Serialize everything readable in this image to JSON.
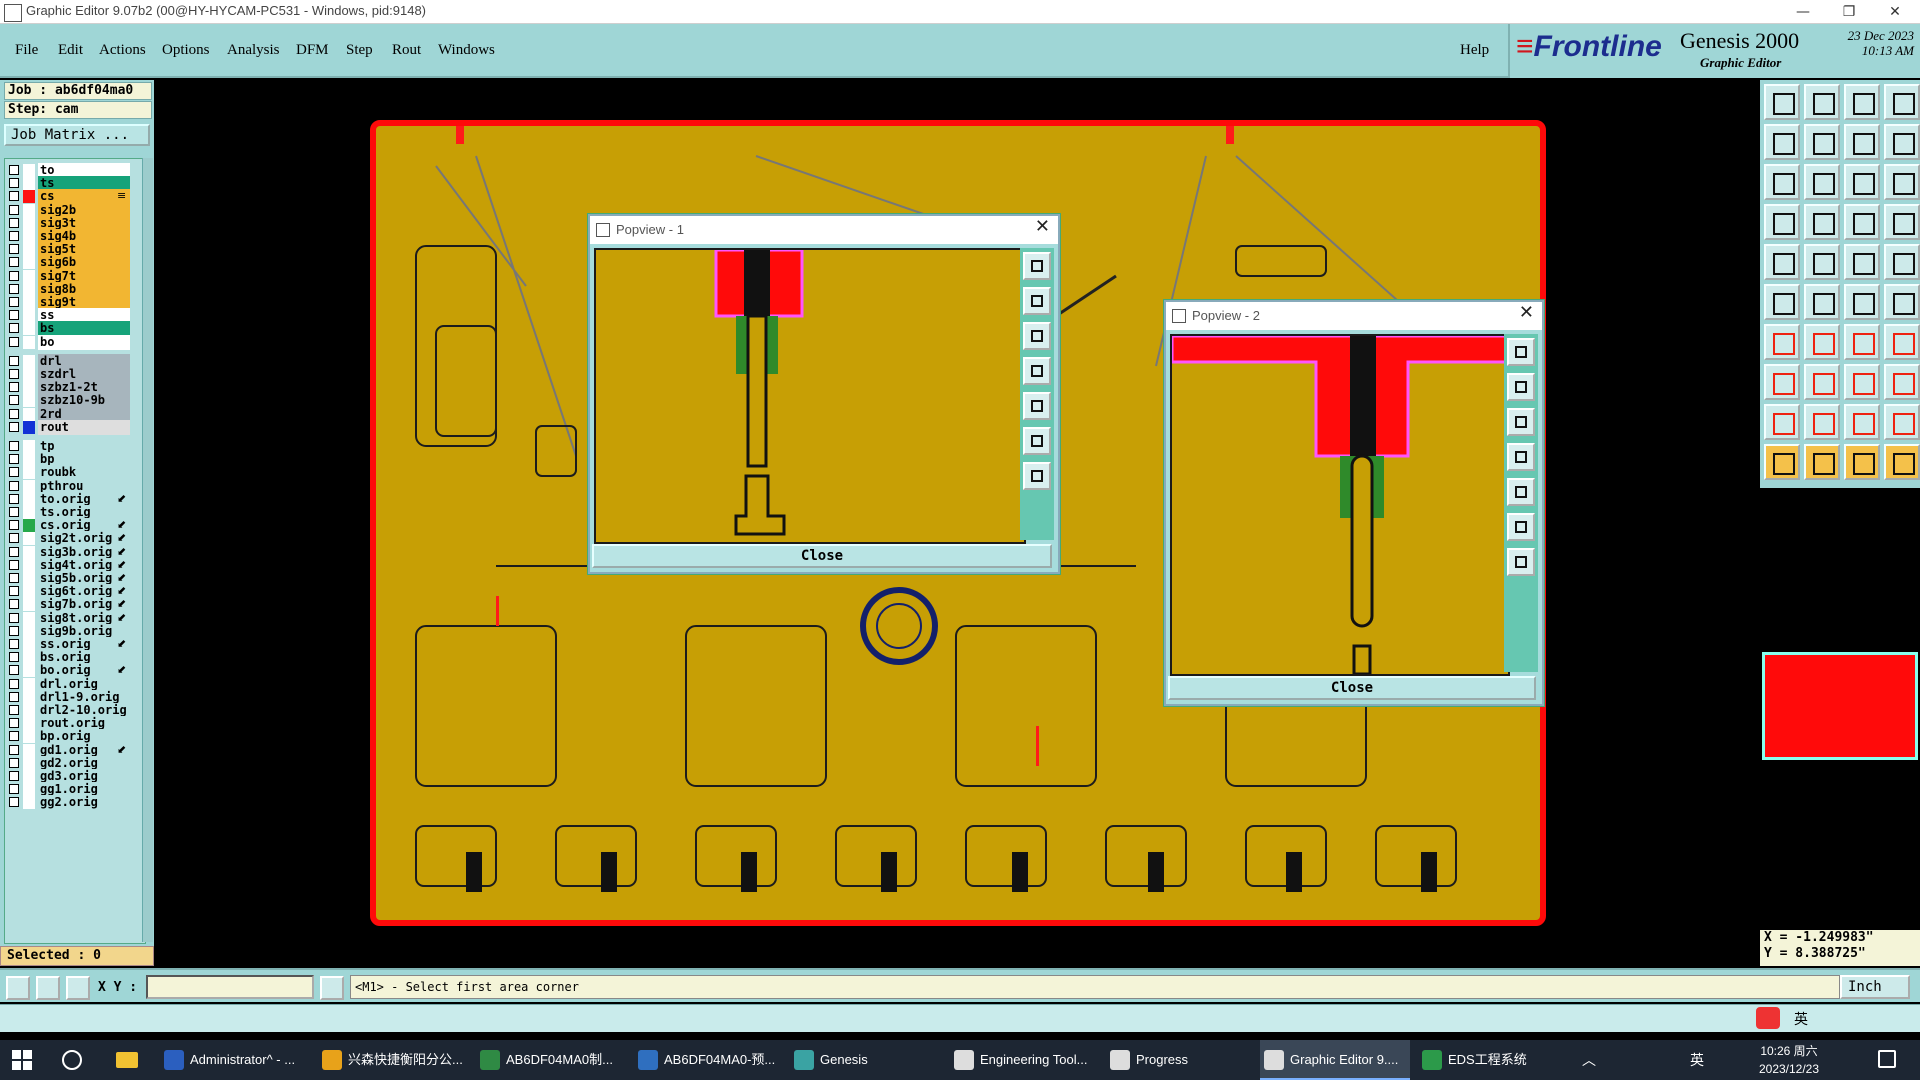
{
  "window": {
    "title": "Graphic Editor 9.07b2 (00@HY-HYCAM-PC531 - Windows, pid:9148)",
    "min_glyph": "—",
    "max_glyph": "❐",
    "close_glyph": "✕"
  },
  "menu": {
    "items": [
      "File",
      "Edit",
      "Actions",
      "Options",
      "Analysis",
      "DFM",
      "Step",
      "Rout",
      "Windows"
    ],
    "help": "Help"
  },
  "logo": {
    "brand": "Frontline",
    "product": "Genesis 2000",
    "subtitle": "Graphic Editor",
    "date": "23 Dec 2023",
    "time": "10:13 AM"
  },
  "job": {
    "job_line": "Job : ab6df04ma0",
    "step_line": "Step: cam",
    "matrix_button": "Job Matrix ..."
  },
  "layers": [
    {
      "name": "to",
      "color": "#ffffff",
      "swatch": "#ffffff"
    },
    {
      "name": "ts",
      "color": "#16a37a",
      "swatch": "#ffffff"
    },
    {
      "name": "cs",
      "color": "#f2b632",
      "swatch": "#ff1010",
      "flag": "≡"
    },
    {
      "name": "sig2b",
      "color": "#f2b632",
      "swatch": "#ffffff"
    },
    {
      "name": "sig3t",
      "color": "#f2b632",
      "swatch": "#ffffff"
    },
    {
      "name": "sig4b",
      "color": "#f2b632",
      "swatch": "#ffffff"
    },
    {
      "name": "sig5t",
      "color": "#f2b632",
      "swatch": "#ffffff"
    },
    {
      "name": "sig6b",
      "color": "#f2b632",
      "swatch": "#ffffff"
    },
    {
      "name": "sig7t",
      "color": "#f2b632",
      "swatch": "#ffffff"
    },
    {
      "name": "sig8b",
      "color": "#f2b632",
      "swatch": "#ffffff"
    },
    {
      "name": "sig9t",
      "color": "#f2b632",
      "swatch": "#ffffff"
    },
    {
      "name": "ss",
      "color": "#ffffff",
      "swatch": "#ffffff"
    },
    {
      "name": "bs",
      "color": "#16a37a",
      "swatch": "#ffffff"
    },
    {
      "name": "bo",
      "color": "#ffffff",
      "swatch": "#ffffff"
    },
    {
      "name": "drl",
      "color": "#a7b5bd",
      "swatch": "#ffffff"
    },
    {
      "name": "szdrl",
      "color": "#a7b5bd",
      "swatch": "#ffffff"
    },
    {
      "name": "szbz1-2t",
      "color": "#a7b5bd",
      "swatch": "#ffffff"
    },
    {
      "name": "szbz10-9b",
      "color": "#a7b5bd",
      "swatch": "#ffffff"
    },
    {
      "name": "2rd",
      "color": "#a7b5bd",
      "swatch": "#ffffff"
    },
    {
      "name": "rout",
      "color": "#dedede",
      "swatch": "#1232d6"
    },
    {
      "name": "tp",
      "color": "#b6e0e0",
      "swatch": "#ffffff"
    },
    {
      "name": "bp",
      "color": "#b6e0e0",
      "swatch": "#ffffff"
    },
    {
      "name": "roubk",
      "color": "#b6e0e0",
      "swatch": "#ffffff"
    },
    {
      "name": "pthrou",
      "color": "#b6e0e0",
      "swatch": "#ffffff"
    },
    {
      "name": "to.orig",
      "color": "#b6e0e0",
      "swatch": "#ffffff",
      "flag": "⬋"
    },
    {
      "name": "ts.orig",
      "color": "#b6e0e0",
      "swatch": "#ffffff"
    },
    {
      "name": "cs.orig",
      "color": "#b6e0e0",
      "swatch": "#26a84a",
      "flag": "⬋"
    },
    {
      "name": "sig2t.orig",
      "color": "#b6e0e0",
      "swatch": "#ffffff",
      "flag": "⬋"
    },
    {
      "name": "sig3b.orig",
      "color": "#b6e0e0",
      "swatch": "#ffffff",
      "flag": "⬋"
    },
    {
      "name": "sig4t.orig",
      "color": "#b6e0e0",
      "swatch": "#ffffff",
      "flag": "⬋"
    },
    {
      "name": "sig5b.orig",
      "color": "#b6e0e0",
      "swatch": "#ffffff",
      "flag": "⬋"
    },
    {
      "name": "sig6t.orig",
      "color": "#b6e0e0",
      "swatch": "#ffffff",
      "flag": "⬋"
    },
    {
      "name": "sig7b.orig",
      "color": "#b6e0e0",
      "swatch": "#ffffff",
      "flag": "⬋"
    },
    {
      "name": "sig8t.orig",
      "color": "#b6e0e0",
      "swatch": "#ffffff",
      "flag": "⬋"
    },
    {
      "name": "sig9b.orig",
      "color": "#b6e0e0",
      "swatch": "#ffffff"
    },
    {
      "name": "ss.orig",
      "color": "#b6e0e0",
      "swatch": "#ffffff",
      "flag": "⬋"
    },
    {
      "name": "bs.orig",
      "color": "#b6e0e0",
      "swatch": "#ffffff"
    },
    {
      "name": "bo.orig",
      "color": "#b6e0e0",
      "swatch": "#ffffff",
      "flag": "⬋"
    },
    {
      "name": "drl.orig",
      "color": "#b6e0e0",
      "swatch": "#ffffff"
    },
    {
      "name": "drl1-9.orig",
      "color": "#b6e0e0",
      "swatch": "#ffffff"
    },
    {
      "name": "drl2-10.orig",
      "color": "#b6e0e0",
      "swatch": "#ffffff"
    },
    {
      "name": "rout.orig",
      "color": "#b6e0e0",
      "swatch": "#ffffff"
    },
    {
      "name": "bp.orig",
      "color": "#b6e0e0",
      "swatch": "#ffffff"
    },
    {
      "name": "gd1.orig",
      "color": "#b6e0e0",
      "swatch": "#ffffff",
      "flag": "⬋"
    },
    {
      "name": "gd2.orig",
      "color": "#b6e0e0",
      "swatch": "#ffffff"
    },
    {
      "name": "gd3.orig",
      "color": "#b6e0e0",
      "swatch": "#ffffff"
    },
    {
      "name": "gg1.orig",
      "color": "#b6e0e0",
      "swatch": "#ffffff"
    },
    {
      "name": "gg2.orig",
      "color": "#b6e0e0",
      "swatch": "#ffffff"
    }
  ],
  "selected": "Selected : 0",
  "popup1": {
    "title": "Popview - 1",
    "close_label": "Close"
  },
  "popup2": {
    "title": "Popview - 2",
    "close_label": "Close"
  },
  "status": {
    "xy_label": "X Y :",
    "xy_value": "",
    "prompt": "<M1> - Select first area corner",
    "unit": "Inch"
  },
  "coords": {
    "x": "X = -1.249983\"",
    "y": "Y = 8.388725\""
  },
  "ime": {
    "label": "英"
  },
  "taskbar": {
    "apps": [
      {
        "label": "Administrator^ - ...",
        "color": "#2b5fbf"
      },
      {
        "label": "兴森快捷衡阳分公...",
        "color": "#e8a21a"
      },
      {
        "label": "AB6DF04MA0制...",
        "color": "#2f8a44"
      },
      {
        "label": "AB6DF04MA0-预...",
        "color": "#2f6fbf"
      },
      {
        "label": "Genesis",
        "color": "#3aa3a3"
      },
      {
        "label": "Engineering Tool...",
        "color": "#dddddd"
      },
      {
        "label": "Progress",
        "color": "#dddddd"
      },
      {
        "label": "Graphic Editor 9....",
        "color": "#dddddd"
      },
      {
        "label": "EDS工程系统",
        "color": "#2c9a4a"
      }
    ],
    "tray_lang": "英",
    "time": "10:26 周六",
    "date": "2023/12/23"
  }
}
